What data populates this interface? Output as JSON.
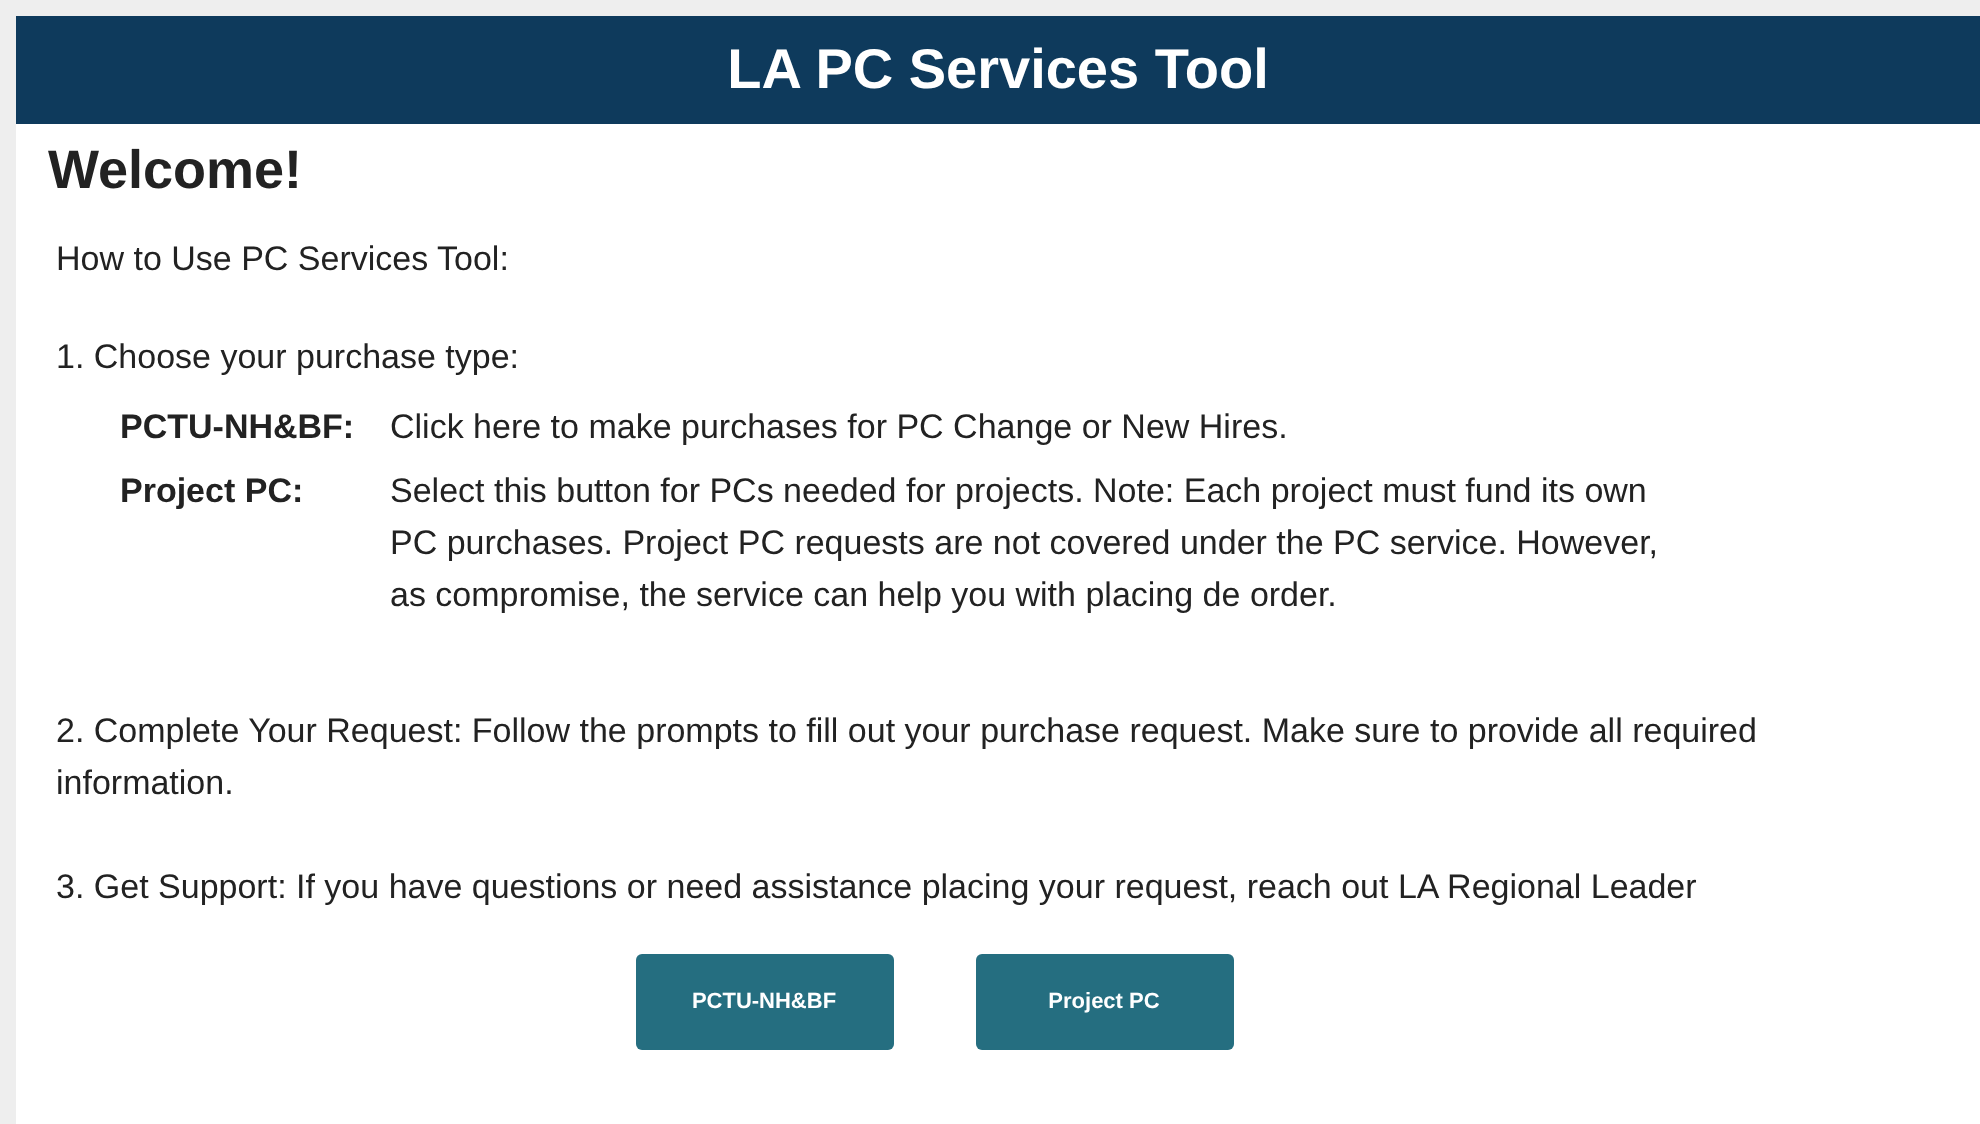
{
  "header": {
    "title": "LA PC Services Tool"
  },
  "heading": "Welcome!",
  "intro": "How to Use PC Services Tool:",
  "steps": [
    {
      "kind": "options",
      "text": "1. Choose your purchase type:",
      "options": [
        {
          "term": "PCTU-NH&BF:",
          "description": "Click here to make purchases for PC Change or New Hires."
        },
        {
          "term": "Project PC:",
          "description": "Select this button for PCs needed for projects. Note: Each project must fund its own PC purchases. Project PC requests are not covered under the PC service. However, as compromise, the service can help you with placing de order."
        }
      ]
    },
    {
      "kind": "plain",
      "text": "2. Complete Your Request: Follow the prompts to fill out your purchase request. Make sure to provide all required information."
    },
    {
      "kind": "plain",
      "text": "3. Get Support: If you have questions or need assistance placing your request, reach out LA Regional Leader"
    }
  ],
  "buttons": [
    "PCTU-NH&BF",
    "Project PC"
  ]
}
